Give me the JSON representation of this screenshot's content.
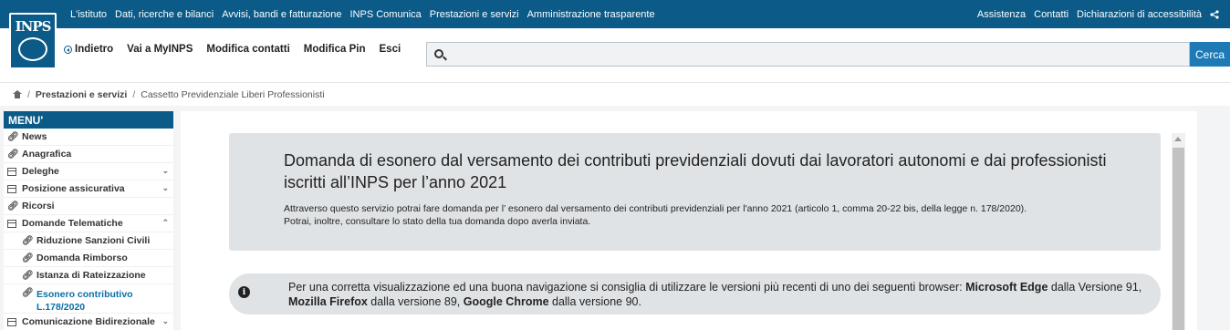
{
  "topbar": {
    "nav": [
      "L'istituto",
      "Dati, ricerche e bilanci",
      "Avvisi, bandi e fatturazione",
      "INPS Comunica",
      "Prestazioni e servizi",
      "Amministrazione trasparente"
    ],
    "right": [
      "Assistenza",
      "Contatti",
      "Dichiarazioni di accessibilità"
    ],
    "share_icon": "share-icon"
  },
  "logo": {
    "text": "INPS"
  },
  "secondary_nav": {
    "back": "Indietro",
    "myinps": "Vai a MyINPS",
    "contacts": "Modifica contatti",
    "pin": "Modifica Pin",
    "exit": "Esci"
  },
  "search": {
    "placeholder": "",
    "value": "",
    "button": "Cerca"
  },
  "breadcrumb": {
    "level1": "Prestazioni e servizi",
    "current": "Cassetto Previdenziale Liberi Professionisti"
  },
  "sidebar": {
    "title": "MENU'",
    "items": [
      {
        "label": "News",
        "icon": "link-icon"
      },
      {
        "label": "Anagrafica",
        "icon": "link-icon"
      },
      {
        "label": "Deleghe",
        "icon": "table-icon",
        "expandable": true
      },
      {
        "label": "Posizione assicurativa",
        "icon": "table-icon",
        "expandable": true
      },
      {
        "label": "Ricorsi",
        "icon": "link-icon"
      },
      {
        "label": "Domande Telematiche",
        "icon": "table-icon",
        "expanded": true
      },
      {
        "label": "Riduzione Sanzioni Civili",
        "icon": "link-icon",
        "sub": true
      },
      {
        "label": "Domanda Rimborso",
        "icon": "link-icon",
        "sub": true
      },
      {
        "label": "Istanza di Rateizzazione",
        "icon": "link-icon",
        "sub": true
      },
      {
        "label": "Esonero contributivo",
        "label2": "L.178/2020",
        "icon": "link-icon",
        "sub": true,
        "active": true
      },
      {
        "label": "Comunicazione Bidirezionale",
        "icon": "table-icon",
        "expandable": true
      }
    ]
  },
  "main": {
    "title": "Domanda di esonero dal versamento dei contributi previdenziali dovuti dai lavoratori autonomi e dai professionisti iscritti all’INPS per l’anno 2021",
    "desc1": "Attraverso questo servizio potrai fare domanda per l’ esonero dal versamento dei contributi previdenziali per l'anno 2021 (articolo 1, comma 20-22 bis, della legge n. 178/2020).",
    "desc2": "Potrai, inoltre, consultare lo stato della tua domanda dopo averla inviata.",
    "info": {
      "part1": "Per una corretta visualizzazione ed una buona navigazione si consiglia di utilizzare le versioni più recenti di uno dei seguenti browser: ",
      "edge": "Microsoft Edge",
      "part2": " dalla Versione 91, ",
      "firefox": "Mozilla Firefox",
      "part3": " dalla versione 89, ",
      "chrome": "Google Chrome",
      "part4": " dalla versione 90."
    }
  },
  "colors": {
    "primary": "#0b5a87",
    "button": "#1d7ab5",
    "active_link": "#0b6fa8"
  }
}
